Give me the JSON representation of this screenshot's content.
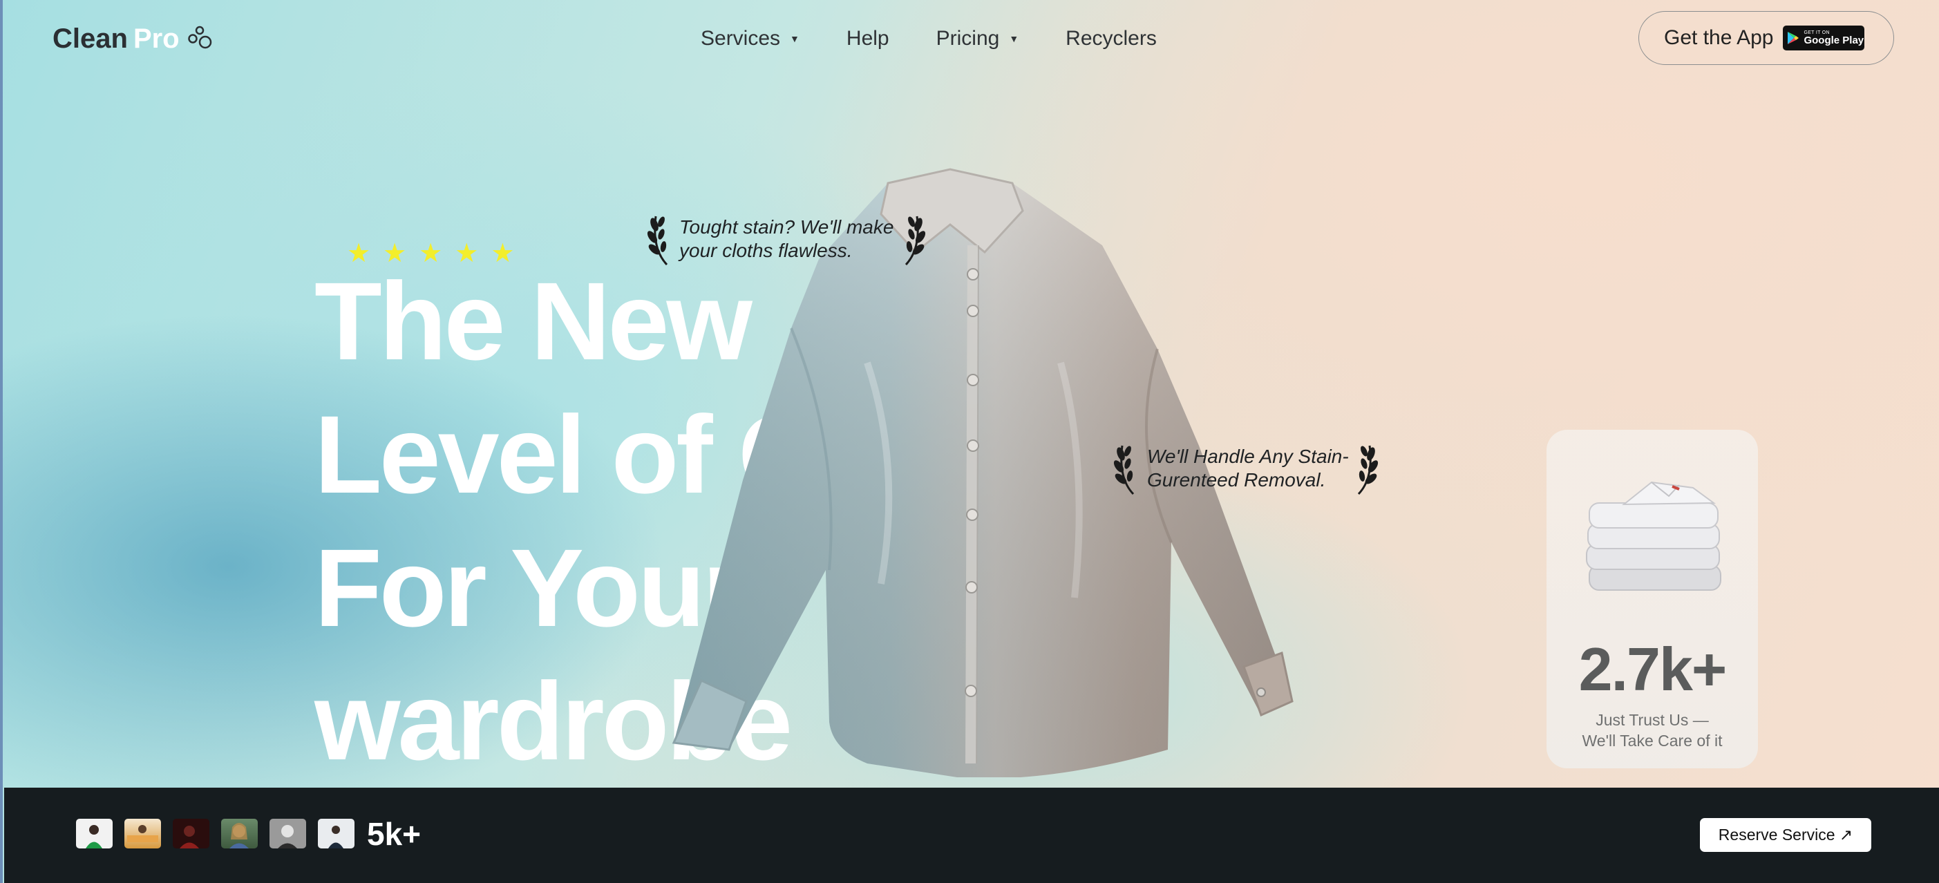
{
  "brand": {
    "name_part1": "Clean",
    "name_part2": "Pro",
    "icon": "bubbles-icon"
  },
  "nav": {
    "items": [
      {
        "label": "Services",
        "has_dropdown": true
      },
      {
        "label": "Help",
        "has_dropdown": false
      },
      {
        "label": "Pricing",
        "has_dropdown": true
      },
      {
        "label": "Recyclers",
        "has_dropdown": false
      }
    ],
    "get_app_label": "Get the App",
    "google_play": {
      "small": "GET IT ON",
      "big": "Google Play"
    }
  },
  "hero": {
    "rating_stars": 5,
    "headline": [
      "The New",
      "Level of Care",
      "For Your",
      "wardrobe"
    ],
    "badges": [
      {
        "line1": "Tought stain? We'll make",
        "line2": "your cloths flawless."
      },
      {
        "line1": "We'll Handle Any Stain-",
        "line2": "Gurenteed Removal."
      }
    ]
  },
  "stats_card": {
    "value": "2.7k+",
    "caption_line1": "Just Trust Us —",
    "caption_line2": "We'll Take Care of it"
  },
  "footer_bar": {
    "customer_count": "5k+",
    "reserve_label": "Reserve Service ↗"
  },
  "colors": {
    "star": "#f3ee2b",
    "bar": "#161c1f",
    "headline": "#ffffff"
  }
}
